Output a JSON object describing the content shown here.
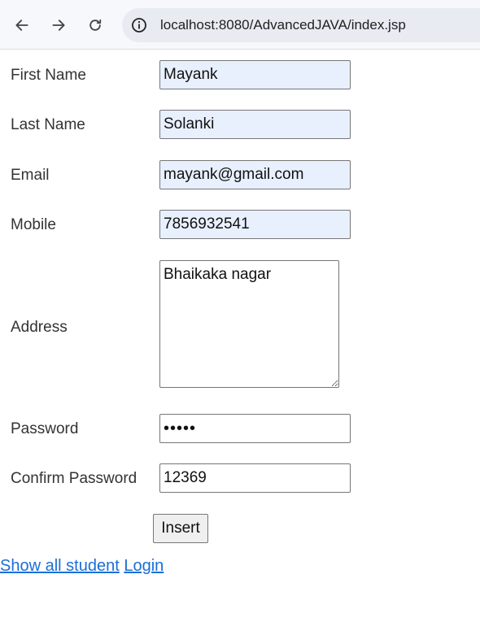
{
  "browser": {
    "url": "localhost:8080/AdvancedJAVA/index.jsp",
    "icons": [
      "back-arrow-icon",
      "forward-arrow-icon",
      "reload-icon",
      "site-info-icon"
    ]
  },
  "form": {
    "first_name": {
      "label": "First Name",
      "value": "Mayank"
    },
    "last_name": {
      "label": "Last Name",
      "value": "Solanki"
    },
    "email": {
      "label": "Email",
      "value": "mayank@gmail.com"
    },
    "mobile": {
      "label": "Mobile",
      "value": "7856932541"
    },
    "address": {
      "label": "Address",
      "value": "Bhaikaka nagar"
    },
    "password": {
      "label": "Password",
      "value": "•••••"
    },
    "confirm_password": {
      "label": "Confirm Password",
      "value": "12369"
    },
    "submit_label": "Insert"
  },
  "links": {
    "show_all": "Show all student",
    "login": "Login"
  },
  "colors": {
    "autofill_bg": "#e8f0fe",
    "link": "#1a6fd6",
    "toolbar_bg": "#f7f8fc",
    "urlbar_bg": "#e8ebf2"
  }
}
